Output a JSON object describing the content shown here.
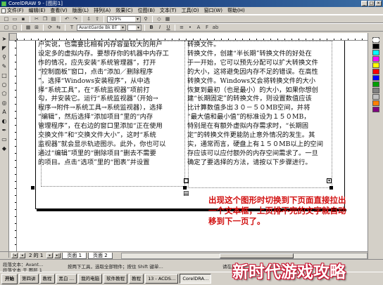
{
  "window": {
    "title": "CorelDRAW 9 - [图形1]"
  },
  "menu": [
    "文件(F)",
    "编辑(E)",
    "查看(V)",
    "版面(L)",
    "排列(A)",
    "效果(C)",
    "位图(B)",
    "文本(T)",
    "工具(O)",
    "窗口(W)",
    "帮助(H)"
  ],
  "toolbar": {
    "zoom": "329%",
    "font": "AvantGarde Bk BT"
  },
  "document": {
    "left_column": [
      "户实说，也需要比相有内存容量较大的用户",
      "设定多的虚拟内存。要想存你的机器中内存工",
      "作的情况，应先安装“系统管理器”，打开",
      "“控制面板”窗口，点击“添加／删除程序",
      "”，选择“Windows安装程序”，从中选",
      "择“系统工具”，在“系统监视器”项前打",
      "勾，并安装它。运行“系统监视器”（开始→",
      "程序→附件→系统工具→系统监视器），选择",
      "“编辑”，然后选择“添加项目”里的“内存",
      "管理程序”，在右边的窗口里添加“正在使用",
      "交换文件”和“交换文件大小”，这时“系统",
      "监视器”就会显示轨迹图示。此外，你也可以",
      "通过“编辑”项里的“删除项目”删去不需要",
      "的项目。点击“选项”里的“图表”并设置"
    ],
    "right_column": [
      "转换文件。",
      "转换文件，创建“半长期”转换文件的好处在",
      "于一开始，它可以预先分配可以扩大转换文件",
      "的大小，这将避免因内存不足的错误。在高性",
      "转换文件。Windows又会将转换文件的大小",
      "恢复到最初（也是最小）的大小，如果你想创",
      "建“长期固定”的转换文件，则设置数值应该",
      "比计算数值多出３０－５０MB空间，并将",
      "“最大值和最小值”的标准设为１５０MB，",
      "特别是在有额外虚拟内存需求时，“长期固",
      "定”的转换文件更能防止意外情况的发生。其",
      "实，通常而言，硬盘上有１５０MB以上的空间",
      "存应该可以应付额外的内存空间需求了。一旦",
      "确定了要选择的方法，请按以下步骤进行。"
    ],
    "annotation": "出现这个图形时切换到下页面直接拉出一个文本框，上页排不完的文字就自动移到下一页了。"
  },
  "pagenav": {
    "counter": "2 的 1",
    "tab1": "页面 1",
    "tab2": "页面 2"
  },
  "status": {
    "line1": "段落文本：Avant...",
    "line2": "段落文本 于 图层 1",
    "hint": "按两下工具，选取全部物件；按住 Shift 键单…",
    "right": "请在属性…"
  },
  "taskbar": {
    "start": "开始",
    "buttons": [
      "第四讲",
      "教程",
      "黑白 …",
      "我的电脑",
      "软件教程",
      "教程",
      "13 - ACDS…",
      "CorelDRA…"
    ]
  },
  "watermark": "新时代游戏攻略"
}
